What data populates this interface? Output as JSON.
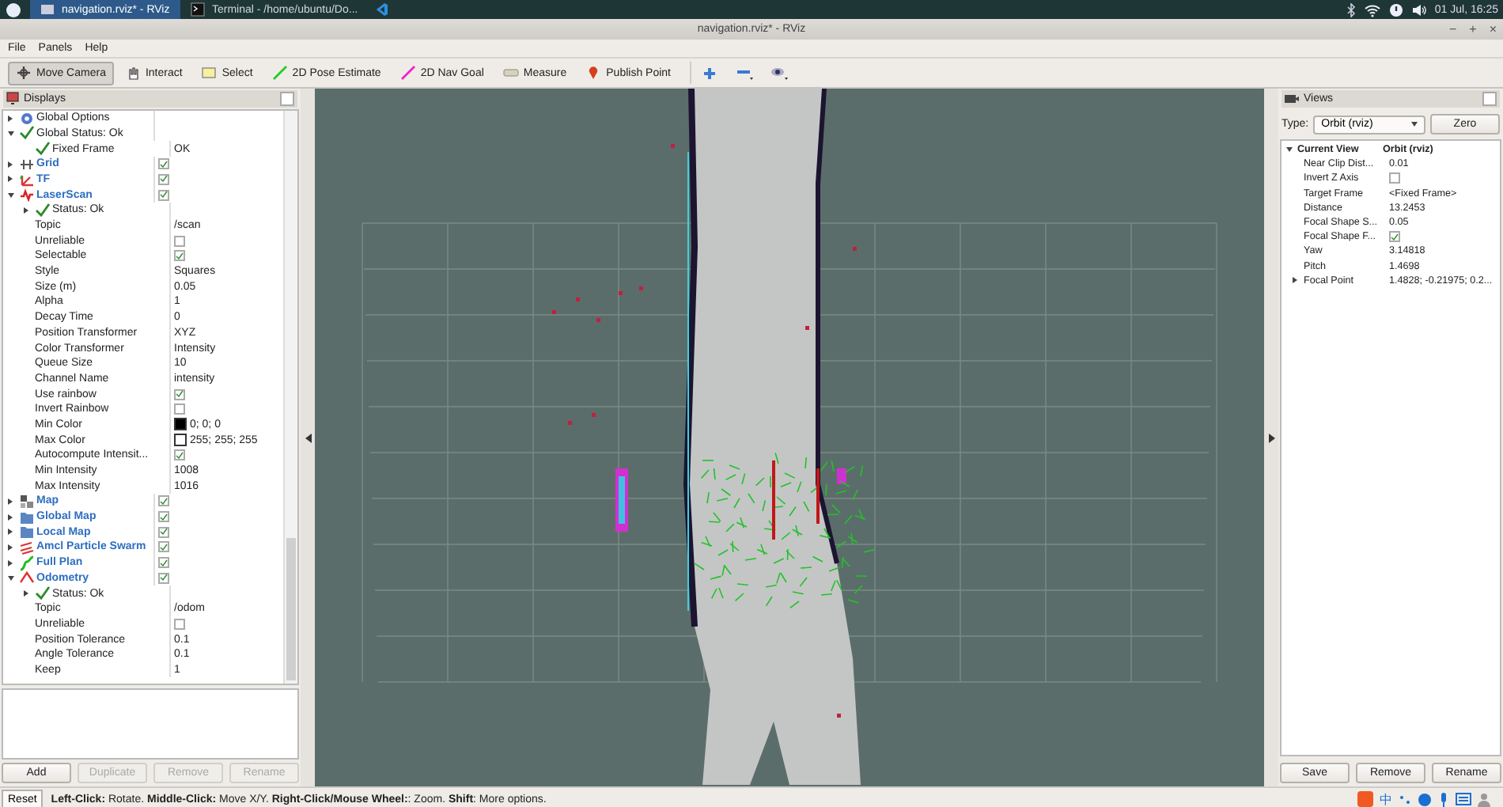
{
  "taskbar": {
    "tasks": [
      {
        "label": "navigation.rviz* - RViz",
        "selected": true
      },
      {
        "label": "Terminal - /home/ubuntu/Do...",
        "selected": false
      },
      {
        "selected": false
      }
    ],
    "clock": "01 Jul, 16:25"
  },
  "window": {
    "title": "navigation.rviz* - RViz",
    "controls": [
      "−",
      "+",
      "×"
    ]
  },
  "menu": [
    "File",
    "Panels",
    "Help"
  ],
  "toolbar": [
    {
      "label": "Move Camera",
      "selected": true
    },
    {
      "label": "Interact",
      "selected": false
    },
    {
      "label": "Select",
      "selected": false
    },
    {
      "label": "2D Pose Estimate",
      "selected": false
    },
    {
      "label": "2D Nav Goal",
      "selected": false
    },
    {
      "label": "Measure",
      "selected": false
    },
    {
      "label": "Publish Point",
      "selected": false
    }
  ],
  "displays": {
    "title": "Displays",
    "items": [
      {
        "kind": "options",
        "label": "Global Options",
        "expanded": false
      },
      {
        "kind": "status",
        "label": "Global Status: Ok",
        "expanded": true,
        "children": [
          {
            "kind": "status",
            "label": "Fixed Frame",
            "value": "OK"
          }
        ]
      },
      {
        "kind": "grid",
        "label": "Grid",
        "expanded": false,
        "checked": true
      },
      {
        "kind": "tf",
        "label": "TF",
        "expanded": false,
        "checked": true
      },
      {
        "kind": "laserscan",
        "label": "LaserScan",
        "expanded": true,
        "checked": true,
        "children": [
          {
            "kind": "status",
            "label": "Status: Ok",
            "expanded": false
          },
          {
            "kind": "property",
            "label": "Topic",
            "value": "/scan"
          },
          {
            "kind": "property",
            "label": "Unreliable",
            "checked": false
          },
          {
            "kind": "property",
            "label": "Selectable",
            "checked": true
          },
          {
            "kind": "property",
            "label": "Style",
            "value": "Squares"
          },
          {
            "kind": "property",
            "label": "Size (m)",
            "value": "0.05"
          },
          {
            "kind": "property",
            "label": "Alpha",
            "value": "1"
          },
          {
            "kind": "property",
            "label": "Decay Time",
            "value": "0"
          },
          {
            "kind": "property",
            "label": "Position Transformer",
            "value": "XYZ"
          },
          {
            "kind": "property",
            "label": "Color Transformer",
            "value": "Intensity"
          },
          {
            "kind": "property",
            "label": "Queue Size",
            "value": "10"
          },
          {
            "kind": "property",
            "label": "Channel Name",
            "value": "intensity"
          },
          {
            "kind": "property",
            "label": "Use rainbow",
            "checked": true
          },
          {
            "kind": "property",
            "label": "Invert Rainbow",
            "checked": false
          },
          {
            "kind": "property",
            "label": "Min Color",
            "value": "0; 0; 0",
            "color": "#000000"
          },
          {
            "kind": "property",
            "label": "Max Color",
            "value": "255; 255; 255",
            "color": "#ffffff"
          },
          {
            "kind": "property",
            "label": "Autocompute Intensit...",
            "checked": true
          },
          {
            "kind": "property",
            "label": "Min Intensity",
            "value": "1008"
          },
          {
            "kind": "property",
            "label": "Max Intensity",
            "value": "1016"
          }
        ]
      },
      {
        "kind": "map",
        "label": "Map",
        "expanded": false,
        "checked": true
      },
      {
        "kind": "group",
        "label": "Global Map",
        "expanded": false,
        "checked": true
      },
      {
        "kind": "group",
        "label": "Local Map",
        "expanded": false,
        "checked": true
      },
      {
        "kind": "posearray",
        "label": "Amcl Particle Swarm",
        "expanded": false,
        "checked": true
      },
      {
        "kind": "path",
        "label": "Full Plan",
        "expanded": false,
        "checked": true
      },
      {
        "kind": "odometry",
        "label": "Odometry",
        "expanded": true,
        "checked": true,
        "children": [
          {
            "kind": "status",
            "label": "Status: Ok",
            "expanded": false
          },
          {
            "kind": "property",
            "label": "Topic",
            "value": "/odom"
          },
          {
            "kind": "property",
            "label": "Unreliable",
            "checked": false
          },
          {
            "kind": "property",
            "label": "Position Tolerance",
            "value": "0.1"
          },
          {
            "kind": "property",
            "label": "Angle Tolerance",
            "value": "0.1"
          },
          {
            "kind": "property",
            "label": "Keep",
            "value": "1"
          }
        ]
      }
    ],
    "buttons": [
      {
        "label": "Add",
        "disabled": false
      },
      {
        "label": "Duplicate",
        "disabled": true
      },
      {
        "label": "Remove",
        "disabled": true
      },
      {
        "label": "Rename",
        "disabled": true
      }
    ]
  },
  "views": {
    "title": "Views",
    "type_label": "Type:",
    "type_value": "Orbit (rviz)",
    "zero_button": "Zero",
    "current": {
      "label": "Current View",
      "value": "Orbit (rviz)",
      "expanded": true,
      "children": [
        {
          "label": "Near Clip Dist...",
          "value": "0.01"
        },
        {
          "label": "Invert Z Axis",
          "checked": false
        },
        {
          "label": "Target Frame",
          "value": "<Fixed Frame>"
        },
        {
          "label": "Distance",
          "value": "13.2453"
        },
        {
          "label": "Focal Shape S...",
          "value": "0.05"
        },
        {
          "label": "Focal Shape F...",
          "checked": true
        },
        {
          "label": "Yaw",
          "value": "3.14818"
        },
        {
          "label": "Pitch",
          "value": "1.4698"
        },
        {
          "label": "Focal Point",
          "value": "1.4828; -0.21975; 0.2...",
          "expanded": false
        }
      ]
    },
    "buttons": [
      "Save",
      "Remove",
      "Rename"
    ]
  },
  "status_bar": {
    "reset": "Reset",
    "hint": "**Left-Click:** Rotate. **Middle-Click:** Move X/Y. **Right-Click/Mouse Wheel:**: Zoom. **Shift**: More options."
  },
  "ime": {
    "label": "中"
  }
}
